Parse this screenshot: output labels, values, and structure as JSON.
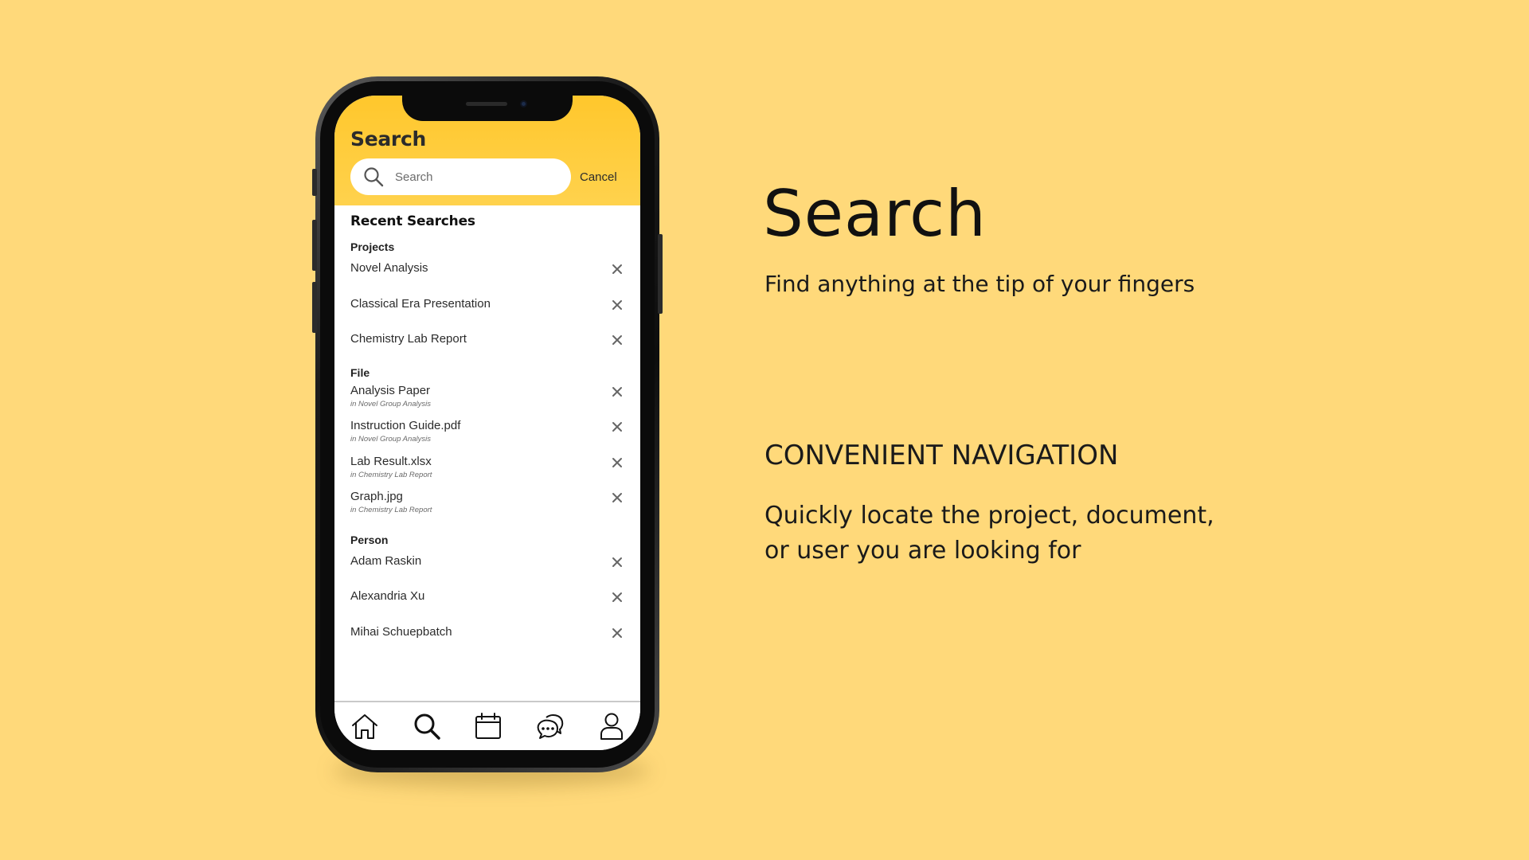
{
  "app": {
    "header_title": "Search",
    "search_placeholder": "Search",
    "cancel_label": "Cancel",
    "accent_color": "#FFC72C"
  },
  "recent": {
    "heading": "Recent Searches",
    "projects": {
      "heading": "Projects",
      "items": [
        {
          "label": "Novel Analysis"
        },
        {
          "label": "Classical Era Presentation"
        },
        {
          "label": "Chemistry Lab Report"
        }
      ]
    },
    "files": {
      "heading": "File",
      "items": [
        {
          "label": "Analysis Paper",
          "location": "in Novel Group Analysis"
        },
        {
          "label": "Instruction Guide.pdf",
          "location": "in Novel Group Analysis"
        },
        {
          "label": "Lab Result.xlsx",
          "location": "in Chemistry Lab Report"
        },
        {
          "label": "Graph.jpg",
          "location": "in Chemistry Lab Report"
        }
      ]
    },
    "people": {
      "heading": "Person",
      "items": [
        {
          "label": "Adam Raskin"
        },
        {
          "label": "Alexandria Xu"
        },
        {
          "label": "Mihai Schuepbatch"
        }
      ]
    }
  },
  "tabbar": {
    "icons": [
      "home-icon",
      "search-icon",
      "calendar-icon",
      "chat-icon",
      "profile-icon"
    ],
    "active": "search-icon"
  },
  "slide": {
    "title": "Search",
    "subtitle": "Find anything at the tip of your fingers",
    "feature_title": "CONVENIENT NAVIGATION",
    "feature_description": "Quickly locate the project, document, or user you are looking for",
    "background_color": "#FFD97A"
  }
}
